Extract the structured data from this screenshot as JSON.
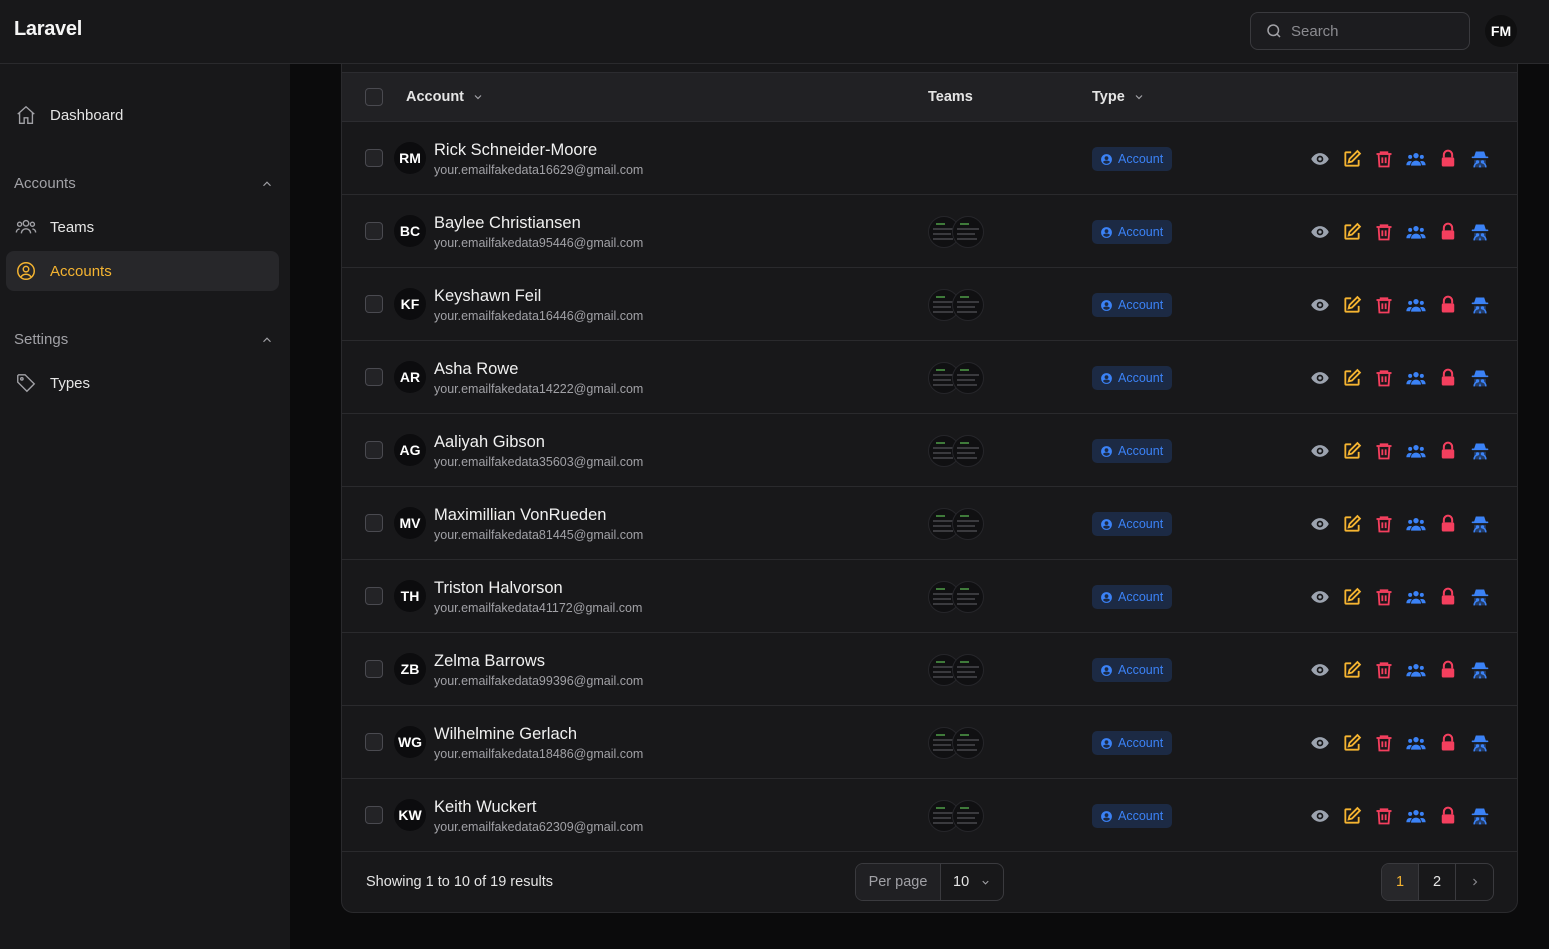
{
  "topbar": {
    "brand": "Laravel",
    "search_placeholder": "Search",
    "user_initials": "FM"
  },
  "sidebar": {
    "dashboard": "Dashboard",
    "group_accounts": "Accounts",
    "teams": "Teams",
    "accounts": "Accounts",
    "group_settings": "Settings",
    "types": "Types"
  },
  "table": {
    "headers": {
      "account": "Account",
      "teams": "Teams",
      "type": "Type"
    },
    "rows": [
      {
        "initials": "RM",
        "name": "Rick Schneider-Moore",
        "email": "your.emailfakedata16629@gmail.com",
        "type": "Account"
      },
      {
        "initials": "BC",
        "name": "Baylee Christiansen",
        "email": "your.emailfakedata95446@gmail.com",
        "type": "Account"
      },
      {
        "initials": "KF",
        "name": "Keyshawn Feil",
        "email": "your.emailfakedata16446@gmail.com",
        "type": "Account"
      },
      {
        "initials": "AR",
        "name": "Asha Rowe",
        "email": "your.emailfakedata14222@gmail.com",
        "type": "Account"
      },
      {
        "initials": "AG",
        "name": "Aaliyah Gibson",
        "email": "your.emailfakedata35603@gmail.com",
        "type": "Account"
      },
      {
        "initials": "MV",
        "name": "Maximillian VonRueden",
        "email": "your.emailfakedata81445@gmail.com",
        "type": "Account"
      },
      {
        "initials": "TH",
        "name": "Triston Halvorson",
        "email": "your.emailfakedata41172@gmail.com",
        "type": "Account"
      },
      {
        "initials": "ZB",
        "name": "Zelma Barrows",
        "email": "your.emailfakedata99396@gmail.com",
        "type": "Account"
      },
      {
        "initials": "WG",
        "name": "Wilhelmine Gerlach",
        "email": "your.emailfakedata18486@gmail.com",
        "type": "Account"
      },
      {
        "initials": "KW",
        "name": "Keith Wuckert",
        "email": "your.emailfakedata62309@gmail.com",
        "type": "Account"
      }
    ]
  },
  "footer": {
    "showing": "Showing 1 to 10 of 19 results",
    "per_page_label": "Per page",
    "per_page_value": "10",
    "pages": [
      "1",
      "2"
    ],
    "current_page": "1"
  },
  "colors": {
    "accent": "#f5b431",
    "view": "#9ca3af",
    "edit": "#f5b431",
    "delete": "#f43f5e",
    "blue": "#3b82f6"
  },
  "icons": {
    "actions": [
      "eye-icon",
      "edit-icon",
      "trash-icon",
      "users-icon",
      "lock-icon",
      "incognito-icon"
    ]
  }
}
